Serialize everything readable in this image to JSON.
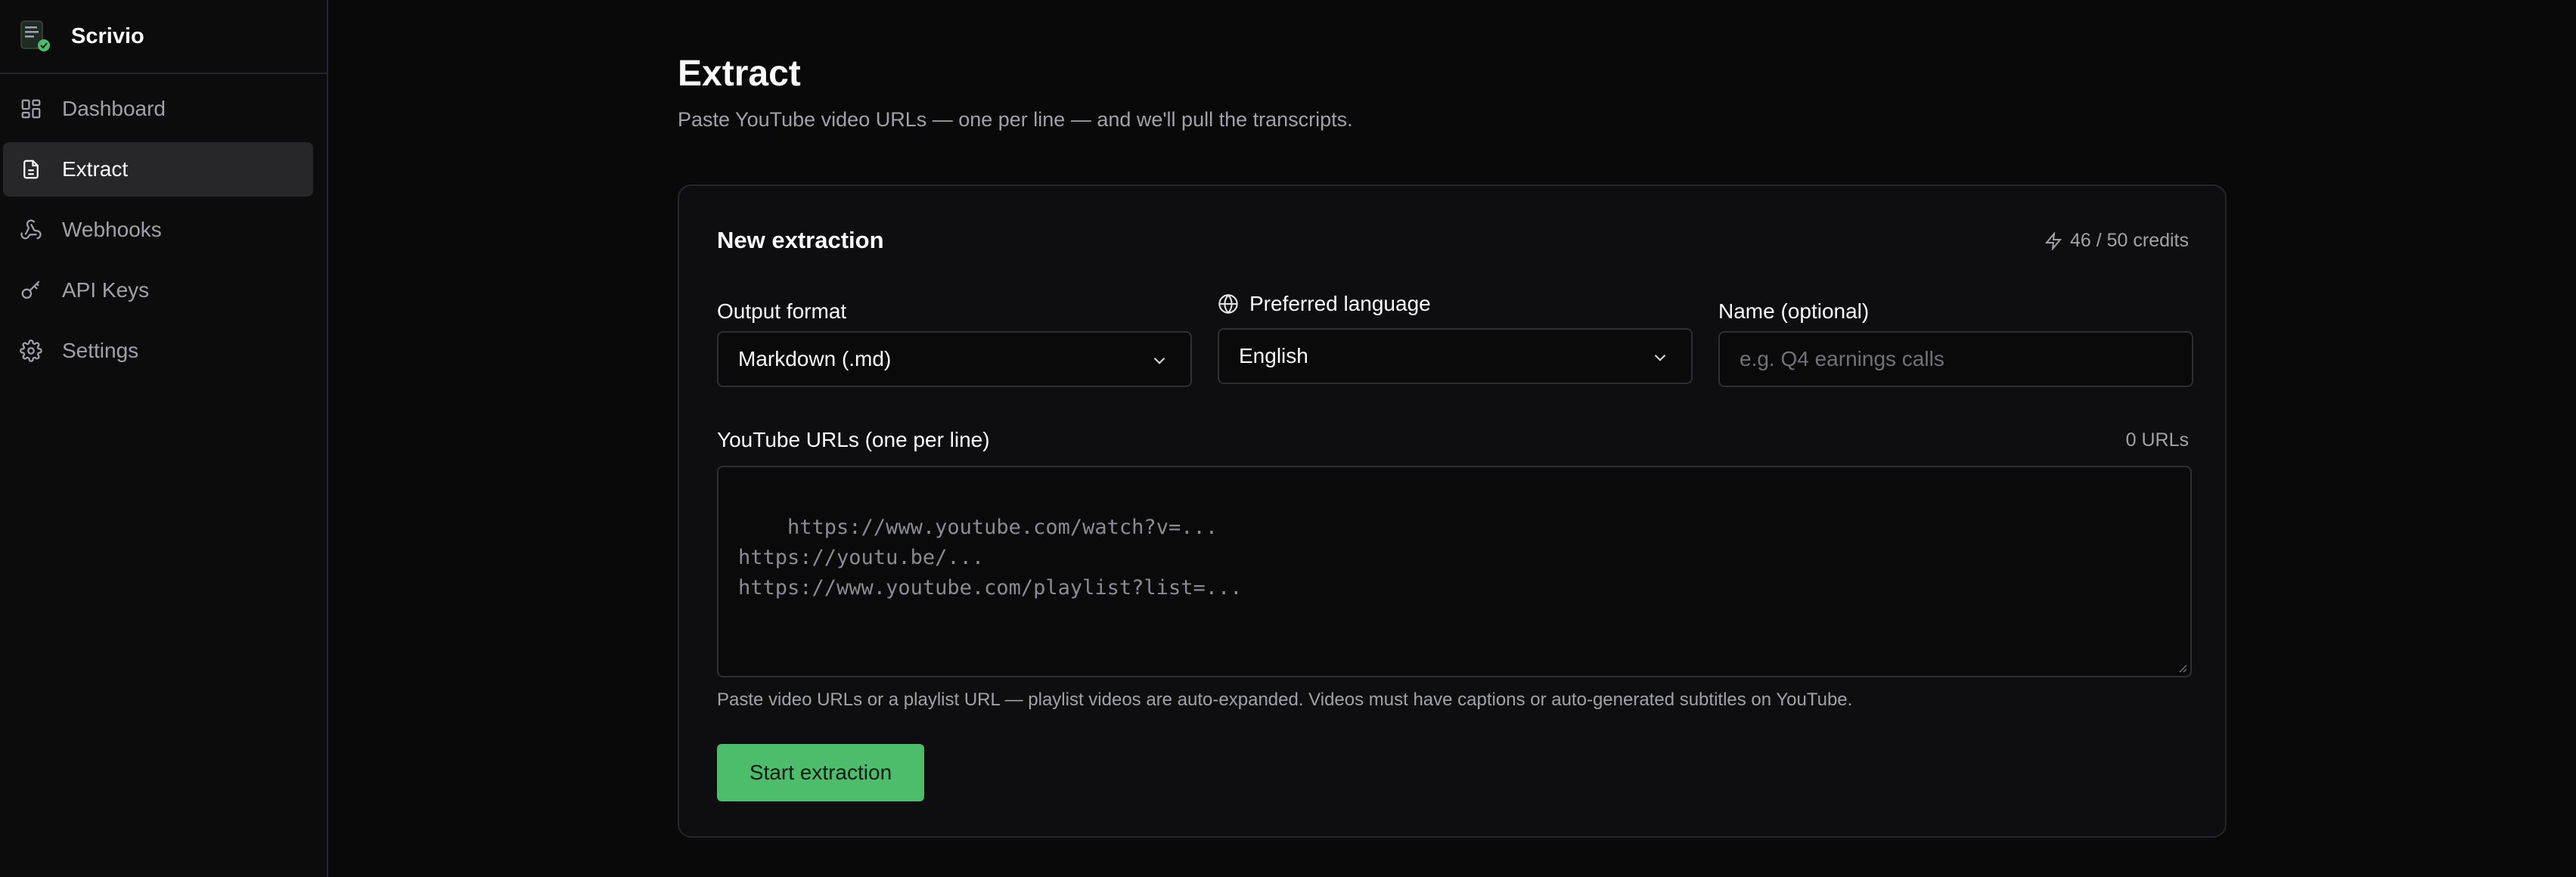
{
  "app": {
    "name": "Scrivio"
  },
  "sidebar": {
    "items": [
      {
        "label": "Dashboard",
        "icon": "dashboard-icon",
        "active": false
      },
      {
        "label": "Extract",
        "icon": "document-icon",
        "active": true
      },
      {
        "label": "Webhooks",
        "icon": "webhook-icon",
        "active": false
      },
      {
        "label": "API Keys",
        "icon": "key-icon",
        "active": false
      },
      {
        "label": "Settings",
        "icon": "gear-icon",
        "active": false
      }
    ]
  },
  "page": {
    "title": "Extract",
    "subtitle": "Paste YouTube video URLs — one per line — and we'll pull the transcripts."
  },
  "card": {
    "title": "New extraction",
    "credits": "46 / 50 credits",
    "output_format": {
      "label": "Output format",
      "value": "Markdown (.md)"
    },
    "language": {
      "label": "Preferred language",
      "value": "English"
    },
    "name": {
      "label": "Name (optional)",
      "placeholder": "e.g. Q4 earnings calls"
    },
    "urls": {
      "label": "YouTube URLs (one per line)",
      "count": "0 URLs",
      "placeholder": "https://www.youtube.com/watch?v=...\nhttps://youtu.be/...\nhttps://www.youtube.com/playlist?list=..."
    },
    "help": "Paste video URLs or a playlist URL — playlist videos are auto-expanded. Videos must have captions or auto-generated subtitles on YouTube.",
    "submit_label": "Start extraction"
  },
  "colors": {
    "accent": "#4cbd6a",
    "background": "#09090a",
    "sidebar_active": "#27272a"
  }
}
